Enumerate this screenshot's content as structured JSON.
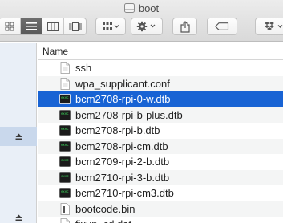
{
  "window": {
    "title": "boot"
  },
  "list": {
    "column_header": "Name",
    "files": [
      {
        "name": "ssh",
        "type": "text"
      },
      {
        "name": "wpa_supplicant.conf",
        "type": "text"
      },
      {
        "name": "bcm2708-rpi-0-w.dtb",
        "type": "exec",
        "selected": true
      },
      {
        "name": "bcm2708-rpi-b-plus.dtb",
        "type": "exec"
      },
      {
        "name": "bcm2708-rpi-b.dtb",
        "type": "exec"
      },
      {
        "name": "bcm2708-rpi-cm.dtb",
        "type": "exec"
      },
      {
        "name": "bcm2709-rpi-2-b.dtb",
        "type": "exec"
      },
      {
        "name": "bcm2710-rpi-3-b.dtb",
        "type": "exec"
      },
      {
        "name": "bcm2710-rpi-cm3.dtb",
        "type": "exec"
      },
      {
        "name": "bootcode.bin",
        "type": "binary"
      },
      {
        "name": "fixup_cd.dat",
        "type": "text"
      }
    ]
  },
  "colors": {
    "selection": "#1863d4",
    "sidebar": "#e9eff7"
  }
}
